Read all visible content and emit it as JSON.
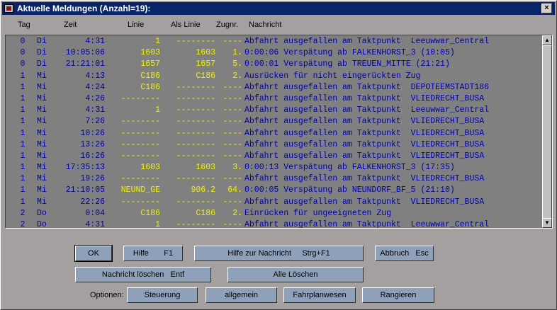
{
  "window": {
    "title": "Aktuelle Meldungen (Anzahl=19):",
    "close_label": "×"
  },
  "columns": {
    "tag": "Tag",
    "zeit": "Zeit",
    "linie": "Linie",
    "als_linie": "Als Linie",
    "zugnr": "Zugnr.",
    "nachricht": "Nachricht"
  },
  "rows": [
    {
      "tag": "0",
      "day": "Di",
      "time": "4:31",
      "linie": "1",
      "als": "--------",
      "zug": "----",
      "msg": "Abfahrt ausgefallen am Taktpunkt  Leeuwwar_Central"
    },
    {
      "tag": "0",
      "day": "Di",
      "time": "10:05:06",
      "linie": "1603",
      "als": "1603",
      "zug": "1.",
      "msg": "0:00:06 Verspätung ab FALKENHORST_3 (10:05)"
    },
    {
      "tag": "0",
      "day": "Di",
      "time": "21:21:01",
      "linie": "1657",
      "als": "1657",
      "zug": "5.",
      "msg": "0:00:01 Verspätung ab TREUEN_MITTE (21:21)"
    },
    {
      "tag": "1",
      "day": "Mi",
      "time": "4:13",
      "linie": "C186",
      "als": "C186",
      "zug": "2.",
      "msg": "Ausrücken für nicht eingerückten Zug"
    },
    {
      "tag": "1",
      "day": "Mi",
      "time": "4:24",
      "linie": "C186",
      "als": "--------",
      "zug": "----",
      "msg": "Abfahrt ausgefallen am Taktpunkt  DEPOTEEMSTADT186"
    },
    {
      "tag": "1",
      "day": "Mi",
      "time": "4:26",
      "linie": "--------",
      "als": "--------",
      "zug": "----",
      "msg": "Abfahrt ausgefallen am Taktpunkt  VLIEDRECHT_BUSA"
    },
    {
      "tag": "1",
      "day": "Mi",
      "time": "4:31",
      "linie": "1",
      "als": "--------",
      "zug": "----",
      "msg": "Abfahrt ausgefallen am Taktpunkt  Leeuwwar_Central"
    },
    {
      "tag": "1",
      "day": "Mi",
      "time": "7:26",
      "linie": "--------",
      "als": "--------",
      "zug": "----",
      "msg": "Abfahrt ausgefallen am Taktpunkt  VLIEDRECHT_BUSA"
    },
    {
      "tag": "1",
      "day": "Mi",
      "time": "10:26",
      "linie": "--------",
      "als": "--------",
      "zug": "----",
      "msg": "Abfahrt ausgefallen am Taktpunkt  VLIEDRECHT_BUSA"
    },
    {
      "tag": "1",
      "day": "Mi",
      "time": "13:26",
      "linie": "--------",
      "als": "--------",
      "zug": "----",
      "msg": "Abfahrt ausgefallen am Taktpunkt  VLIEDRECHT_BUSA"
    },
    {
      "tag": "1",
      "day": "Mi",
      "time": "16:26",
      "linie": "--------",
      "als": "--------",
      "zug": "----",
      "msg": "Abfahrt ausgefallen am Taktpunkt  VLIEDRECHT_BUSA"
    },
    {
      "tag": "1",
      "day": "Mi",
      "time": "17:35:13",
      "linie": "1603",
      "als": "1603",
      "zug": "3.",
      "msg": "0:00:13 Verspätung ab FALKENHORST_3 (17:35)"
    },
    {
      "tag": "1",
      "day": "Mi",
      "time": "19:26",
      "linie": "--------",
      "als": "--------",
      "zug": "----",
      "msg": "Abfahrt ausgefallen am Taktpunkt  VLIEDRECHT_BUSA"
    },
    {
      "tag": "1",
      "day": "Mi",
      "time": "21:10:05",
      "linie": "NEUND_GE",
      "als": "906.2",
      "zug": "64.",
      "msg": "0:00:05 Verspätung ab NEUNDORF_BF_5 (21:10)"
    },
    {
      "tag": "1",
      "day": "Mi",
      "time": "22:26",
      "linie": "--------",
      "als": "--------",
      "zug": "----",
      "msg": "Abfahrt ausgefallen am Taktpunkt  VLIEDRECHT_BUSA"
    },
    {
      "tag": "2",
      "day": "Do",
      "time": "0:04",
      "linie": "C186",
      "als": "C186",
      "zug": "2.",
      "msg": "Einrücken für ungeeigneten Zug"
    },
    {
      "tag": "2",
      "day": "Do",
      "time": "4:31",
      "linie": "1",
      "als": "--------",
      "zug": "----",
      "msg": "Abfahrt ausgefallen am Taktpunkt  Leeuwwar_Central"
    }
  ],
  "buttons": {
    "ok": "OK",
    "hilfe": "Hilfe       F1",
    "hilfe_nachricht": "Hilfe zur Nachricht     Strg+F1",
    "abbruch": "Abbruch   Esc",
    "nachricht_loeschen": "Nachricht löschen   Entf",
    "alle_loeschen": "Alle Löschen"
  },
  "options": {
    "label": "Optionen:",
    "steuerung": "Steuerung",
    "allgemein": "allgemein",
    "fahrplanwesen": "Fahrplanwesen",
    "rangieren": "Rangieren"
  },
  "scroll": {
    "up": "▲",
    "down": "▼"
  }
}
